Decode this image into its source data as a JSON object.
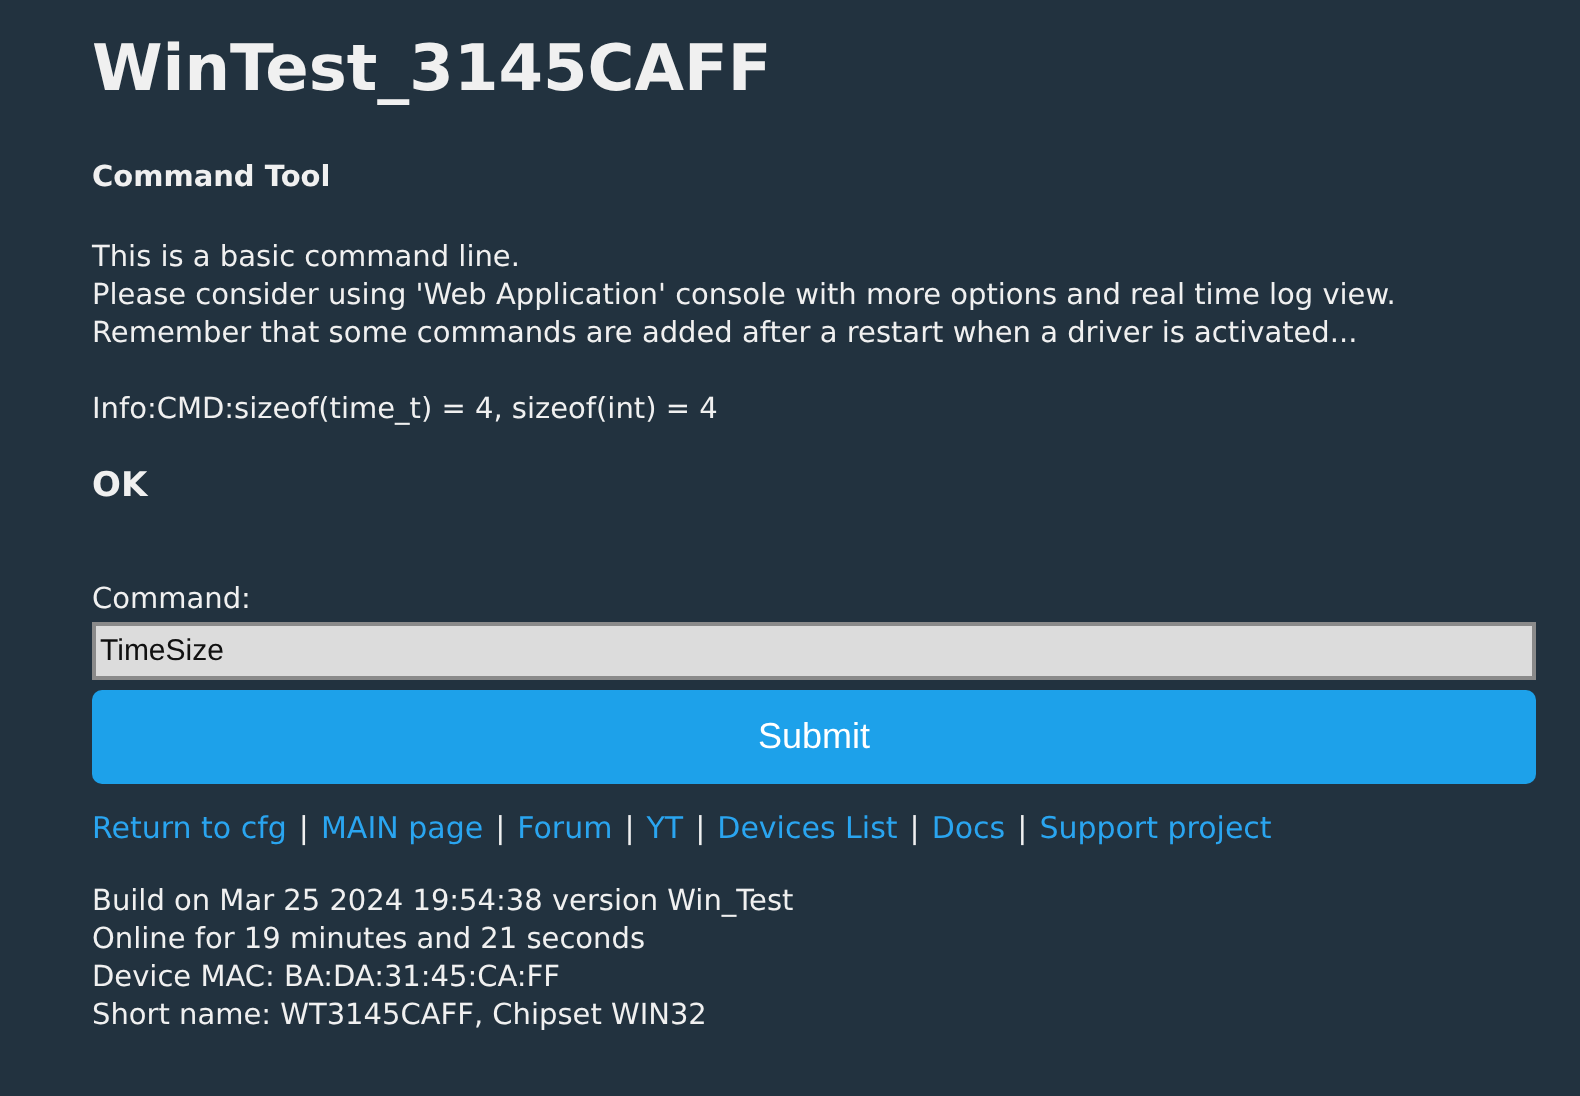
{
  "title": "WinTest_3145CAFF",
  "heading": "Command Tool",
  "intro_lines": [
    "This is a basic command line.",
    "Please consider using 'Web Application' console with more options and real time log view.",
    "Remember that some commands are added after a restart when a driver is activated..."
  ],
  "response": "Info:CMD:sizeof(time_t) = 4, sizeof(int) = 4",
  "status": "OK",
  "command": {
    "label": "Command:",
    "value": "TimeSize"
  },
  "submit": "Submit",
  "links": [
    "Return to cfg",
    "MAIN page",
    "Forum",
    "YT",
    "Devices List",
    "Docs",
    "Support project"
  ],
  "link_separators": [
    "|",
    "|",
    "|",
    "|",
    "|",
    "|"
  ],
  "footer_lines": [
    "Build on Mar 25 2024 19:54:38 version Win_Test",
    "Online for 19 minutes and 21 seconds",
    "Device MAC: BA:DA:31:45:CA:FF",
    "Short name: WT3145CAFF, Chipset WIN32"
  ]
}
